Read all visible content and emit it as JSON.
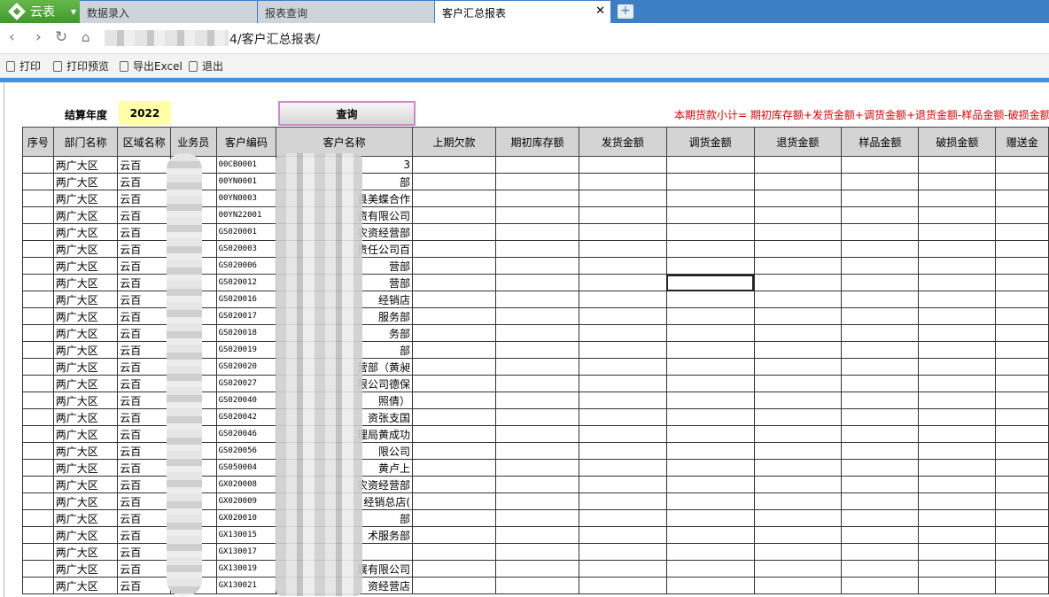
{
  "app": {
    "name": "云表",
    "brand_color": "#4ea938",
    "tabbar_color": "#3c7fc4"
  },
  "tabs": [
    {
      "label": "数据录入",
      "active": false
    },
    {
      "label": "报表查询",
      "active": false
    },
    {
      "label": "客户汇总报表",
      "active": true
    }
  ],
  "icons": {
    "close": "close-icon",
    "new_tab": "plus-icon",
    "back": "back-arrow-icon",
    "forward": "forward-arrow-icon",
    "refresh": "refresh-icon",
    "home": "home-icon"
  },
  "address": {
    "url_suffix": "4/客户汇总报表/"
  },
  "toolbar": {
    "print": "打印",
    "print_preview": "打印预览",
    "export_excel": "导出Excel",
    "exit": "退出"
  },
  "form": {
    "year_label": "结算年度",
    "year_value": "2022",
    "query_button": "查询"
  },
  "formula": "本期货款小计= 期初库存额+发货金额+调货金额+退货金额-样品金额-破损金额-",
  "table": {
    "columns": [
      "序号",
      "部门名称",
      "区域名称",
      "业务员",
      "客户编码",
      "客户名称",
      "上期欠款",
      "期初库存额",
      "发货金额",
      "调货金额",
      "退货金额",
      "样品金额",
      "破损金额",
      "赠送金"
    ],
    "rows": [
      {
        "dept": "两广大区",
        "region": "云百",
        "code": "00CB0001",
        "name_tail": "3"
      },
      {
        "dept": "两广大区",
        "region": "云百",
        "code": "00YN0001",
        "name_tail": "部"
      },
      {
        "dept": "两广大区",
        "region": "云百",
        "code": "00YN0003",
        "name_tail": "县美蝶合作"
      },
      {
        "dept": "两广大区",
        "region": "云百",
        "code": "00YN22001",
        "name_tail": "资有限公司"
      },
      {
        "dept": "两广大区",
        "region": "云百",
        "code": "GS020001",
        "name_tail": "农资经营部"
      },
      {
        "dept": "两广大区",
        "region": "云百",
        "code": "GS020003",
        "name_tail": "责任公司百"
      },
      {
        "dept": "两广大区",
        "region": "云百",
        "code": "GS020006",
        "name_tail": "营部"
      },
      {
        "dept": "两广大区",
        "region": "云百",
        "code": "GS020012",
        "name_tail": "营部"
      },
      {
        "dept": "两广大区",
        "region": "云百",
        "code": "GS020016",
        "name_tail": "经销店"
      },
      {
        "dept": "两广大区",
        "region": "云百",
        "code": "GS020017",
        "name_tail": "服务部"
      },
      {
        "dept": "两广大区",
        "region": "云百",
        "code": "GS020018",
        "name_tail": "务部"
      },
      {
        "dept": "两广大区",
        "region": "云百",
        "code": "GS020019",
        "name_tail": "部"
      },
      {
        "dept": "两广大区",
        "region": "云百",
        "code": "GS020020",
        "name_tail": "营部（黄昶"
      },
      {
        "dept": "两广大区",
        "region": "云百",
        "code": "GS020027",
        "name_tail": "限公司德保"
      },
      {
        "dept": "两广大区",
        "region": "云百",
        "code": "GS020040",
        "name_tail": "照倩）"
      },
      {
        "dept": "两广大区",
        "region": "云百",
        "code": "GS020042",
        "name_tail": "资张支国"
      },
      {
        "dept": "两广大区",
        "region": "云百",
        "code": "GS020046",
        "name_tail": "理局黄成功"
      },
      {
        "dept": "两广大区",
        "region": "云百",
        "code": "GS020056",
        "name_tail": "限公司"
      },
      {
        "dept": "两广大区",
        "region": "云百",
        "code": "GS050004",
        "name_tail": "黄卢上"
      },
      {
        "dept": "两广大区",
        "region": "云百",
        "code": "GX020008",
        "name_tail": "农资经营部"
      },
      {
        "dept": "两广大区",
        "region": "云百",
        "code": "GX020009",
        "name_tail": "经销总店("
      },
      {
        "dept": "两广大区",
        "region": "云百",
        "code": "GX020010",
        "name_tail": "部"
      },
      {
        "dept": "两广大区",
        "region": "云百",
        "code": "GX130015",
        "name_tail": "术服务部"
      },
      {
        "dept": "两广大区",
        "region": "云百",
        "code": "GX130017",
        "name_tail": ""
      },
      {
        "dept": "两广大区",
        "region": "云百",
        "code": "GX130019",
        "name_tail": "展有限公司"
      },
      {
        "dept": "两广大区",
        "region": "云百",
        "code": "GX130021",
        "name_tail": "资经营店"
      }
    ]
  }
}
